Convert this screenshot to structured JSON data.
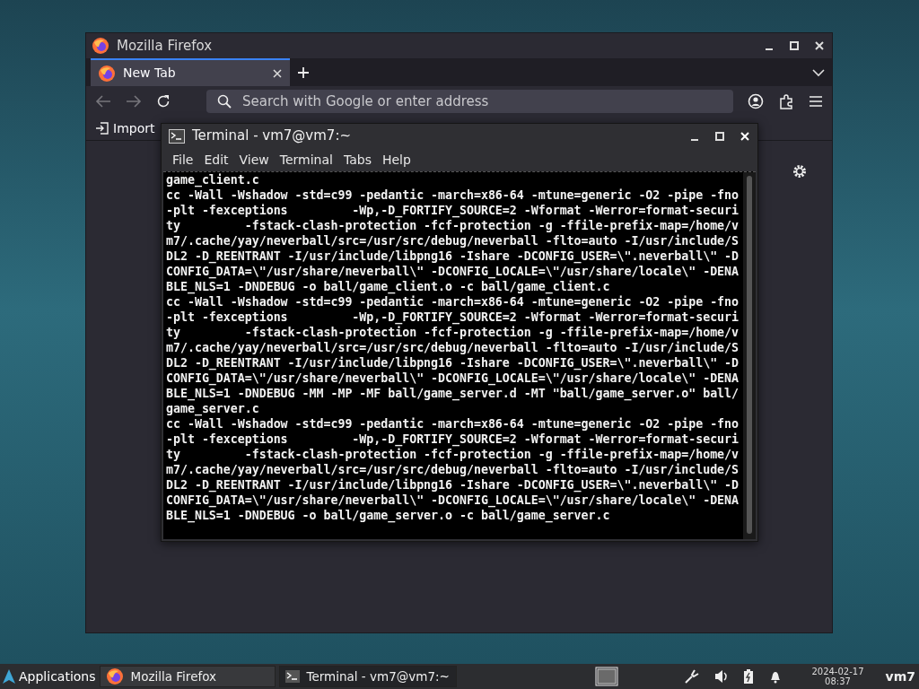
{
  "firefox": {
    "title": "Mozilla Firefox",
    "tabs": [
      {
        "label": "New Tab",
        "selected": true
      }
    ],
    "address_bar": {
      "placeholder": "Search with Google or enter address"
    },
    "bookmarks": [
      {
        "label": "Import"
      }
    ]
  },
  "terminal": {
    "title": "Terminal - vm7@vm7:~",
    "menu": [
      "File",
      "Edit",
      "View",
      "Terminal",
      "Tabs",
      "Help"
    ],
    "lines": [
      "game_client.c",
      "cc -Wall -Wshadow -std=c99 -pedantic -march=x86-64 -mtune=generic -O2 -pipe -fno",
      "-plt -fexceptions         -Wp,-D_FORTIFY_SOURCE=2 -Wformat -Werror=format-securi",
      "ty         -fstack-clash-protection -fcf-protection -g -ffile-prefix-map=/home/v",
      "m7/.cache/yay/neverball/src=/usr/src/debug/neverball -flto=auto -I/usr/include/S",
      "DL2 -D_REENTRANT -I/usr/include/libpng16 -Ishare -DCONFIG_USER=\\\".neverball\\\" -D",
      "CONFIG_DATA=\\\"/usr/share/neverball\\\" -DCONFIG_LOCALE=\\\"/usr/share/locale\\\" -DENA",
      "BLE_NLS=1 -DNDEBUG -o ball/game_client.o -c ball/game_client.c",
      "cc -Wall -Wshadow -std=c99 -pedantic -march=x86-64 -mtune=generic -O2 -pipe -fno",
      "-plt -fexceptions         -Wp,-D_FORTIFY_SOURCE=2 -Wformat -Werror=format-securi",
      "ty         -fstack-clash-protection -fcf-protection -g -ffile-prefix-map=/home/v",
      "m7/.cache/yay/neverball/src=/usr/src/debug/neverball -flto=auto -I/usr/include/S",
      "DL2 -D_REENTRANT -I/usr/include/libpng16 -Ishare -DCONFIG_USER=\\\".neverball\\\" -D",
      "CONFIG_DATA=\\\"/usr/share/neverball\\\" -DCONFIG_LOCALE=\\\"/usr/share/locale\\\" -DENA",
      "BLE_NLS=1 -DNDEBUG -MM -MP -MF ball/game_server.d -MT \"ball/game_server.o\" ball/",
      "game_server.c",
      "cc -Wall -Wshadow -std=c99 -pedantic -march=x86-64 -mtune=generic -O2 -pipe -fno",
      "-plt -fexceptions         -Wp,-D_FORTIFY_SOURCE=2 -Wformat -Werror=format-securi",
      "ty         -fstack-clash-protection -fcf-protection -g -ffile-prefix-map=/home/v",
      "m7/.cache/yay/neverball/src=/usr/src/debug/neverball -flto=auto -I/usr/include/S",
      "DL2 -D_REENTRANT -I/usr/include/libpng16 -Ishare -DCONFIG_USER=\\\".neverball\\\" -D",
      "CONFIG_DATA=\\\"/usr/share/neverball\\\" -DCONFIG_LOCALE=\\\"/usr/share/locale\\\" -DENA",
      "BLE_NLS=1 -DNDEBUG -o ball/game_server.o -c ball/game_server.c"
    ]
  },
  "taskbar": {
    "launcher": "Applications",
    "tasks": [
      {
        "kind": "firefox",
        "label": "Mozilla Firefox",
        "selected": false
      },
      {
        "kind": "terminal",
        "label": "Terminal - vm7@vm7:~",
        "selected": true
      }
    ],
    "date": "2024-02-17",
    "time": "08:37",
    "user": "vm7"
  }
}
